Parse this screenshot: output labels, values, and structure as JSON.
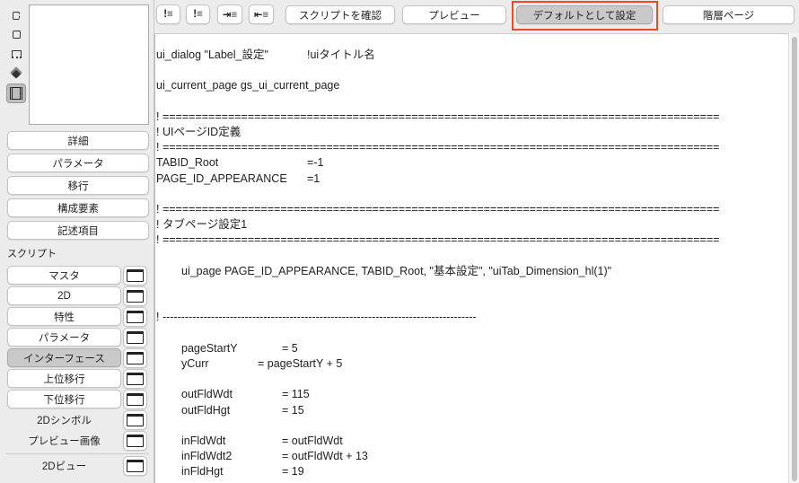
{
  "toolbar": {
    "buttons": [
      "スクリプトを確認",
      "プレビュー",
      "デフォルトとして設定",
      "階層ページ"
    ],
    "highlight_color": "#f04a24"
  },
  "sidebar": {
    "mode_icons": [
      "2d-view-icon",
      "square-icon",
      "floor-plan-icon",
      "3d-cube-icon",
      "interface-script-icon"
    ],
    "sections": [
      "詳細",
      "パラメータ",
      "移行",
      "構成要素",
      "記述項目"
    ],
    "script_label": "スクリプト",
    "scripts": [
      {
        "label": "マスタ"
      },
      {
        "label": "2D"
      },
      {
        "label": "特性"
      },
      {
        "label": "パラメータ"
      },
      {
        "label": "インターフェース",
        "selected": true
      },
      {
        "label": "上位移行"
      },
      {
        "label": "下位移行"
      },
      {
        "label": "2Dシンボル",
        "plain": true
      },
      {
        "label": "プレビュー画像",
        "plain": true
      }
    ],
    "view_2d": "2Dビュー"
  },
  "code": {
    "lines": [
      {
        "t": "ui_dialog \"Label_設定\"",
        "v": "!uiタイトル名",
        "c": 168
      },
      {
        "t": ""
      },
      {
        "t": "ui_current_page gs_ui_current_page"
      },
      {
        "t": ""
      },
      {
        "t": "! ====================================================================================="
      },
      {
        "t": "! UIページID定義"
      },
      {
        "t": "! ====================================================================================="
      },
      {
        "t": "TABID_Root",
        "v": "=-1",
        "c": 168
      },
      {
        "t": "PAGE_ID_APPEARANCE",
        "v": "=1",
        "c": 168
      },
      {
        "t": ""
      },
      {
        "t": "! ====================================================================================="
      },
      {
        "t": "! タブページ設定1"
      },
      {
        "t": "! ====================================================================================="
      },
      {
        "t": ""
      },
      {
        "t": "ui_page PAGE_ID_APPEARANCE, TABID_Root, \"基本設定\", \"uiTab_Dimension_hl(1)\"",
        "i": 28
      },
      {
        "t": ""
      },
      {
        "t": ""
      },
      {
        "t": "! ------------------------------------------------------------------------------------"
      },
      {
        "t": ""
      },
      {
        "t": "pageStartY",
        "v": "= 5",
        "i": 28,
        "c": 112
      },
      {
        "t": "yCurr",
        "v": "= pageStartY + 5",
        "i": 28,
        "c": 85
      },
      {
        "t": ""
      },
      {
        "t": "outFldWdt",
        "v": "= 115",
        "i": 28,
        "c": 112
      },
      {
        "t": "outFldHgt",
        "v": "= 15",
        "i": 28,
        "c": 112
      },
      {
        "t": ""
      },
      {
        "t": "inFldWdt",
        "v": "= outFldWdt",
        "i": 28,
        "c": 112
      },
      {
        "t": "inFldWdt2",
        "v": "= outFldWdt + 13",
        "i": 28,
        "c": 112
      },
      {
        "t": "inFldHgt",
        "v": "= 19",
        "i": 28,
        "c": 112
      }
    ]
  }
}
